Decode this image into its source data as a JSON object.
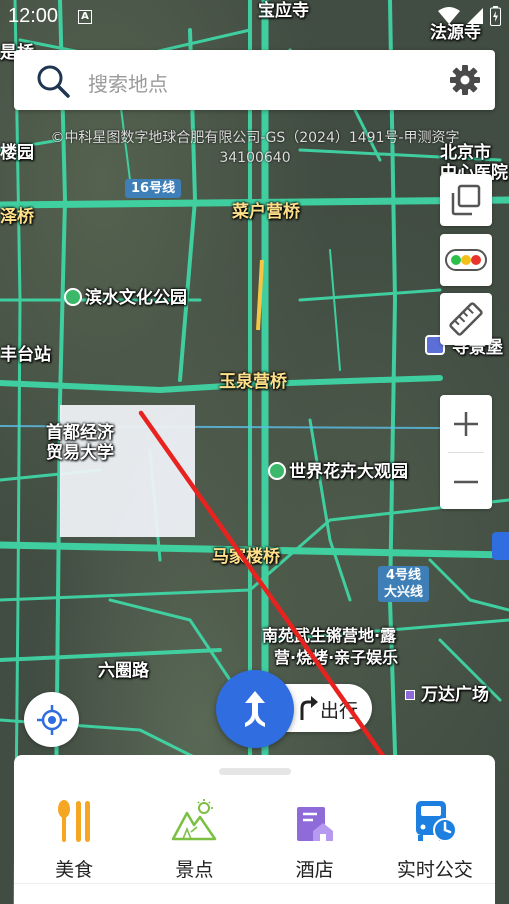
{
  "statusbar": {
    "time": "12:00",
    "notification_icon": "A"
  },
  "search": {
    "placeholder": "搜索地点"
  },
  "copyright": {
    "line1": "©中科星图数字地球合肥有限公司-GS（2024）1491号-甲测资字",
    "line2": "34100640"
  },
  "map": {
    "labels": {
      "top_center": "宝应寺",
      "top_right": "法源寺",
      "left_top": "是桥",
      "left_second": "楼园",
      "right_city": "北京市",
      "right_hospital": "中心医院",
      "metro16": "16号线",
      "left_bridge": "泽桥",
      "caihuying": "菜户营桥",
      "park": "滨水文化公园",
      "fengtai": "丰台站",
      "yuquanying": "玉泉营桥",
      "right_edge": "寻景堡",
      "university_l1": "首都经济",
      "university_l2": "贸易大学",
      "flower_market": "世界花卉大观园",
      "majialou": "马家楼桥",
      "metro4_l1": "4号线",
      "metro4_l2": "大兴线",
      "camp_l1": "南苑武生锵营地·露",
      "camp_l2": "营·烧烤·亲子娱乐",
      "liuquan": "六圈路",
      "wanda": "万达广场"
    }
  },
  "trip": {
    "label": "出行"
  },
  "categories": [
    {
      "label": "美食",
      "icon": "food-icon",
      "color": "#f5a623"
    },
    {
      "label": "景点",
      "icon": "scenic-icon",
      "color": "#7bc043"
    },
    {
      "label": "酒店",
      "icon": "hotel-icon",
      "color": "#8e6bd8"
    },
    {
      "label": "实时公交",
      "icon": "bus-icon",
      "color": "#1d7fe0"
    }
  ],
  "colors": {
    "road": "#3fd9a7",
    "accent": "#2f6de0",
    "arrow": "#e8231f"
  }
}
